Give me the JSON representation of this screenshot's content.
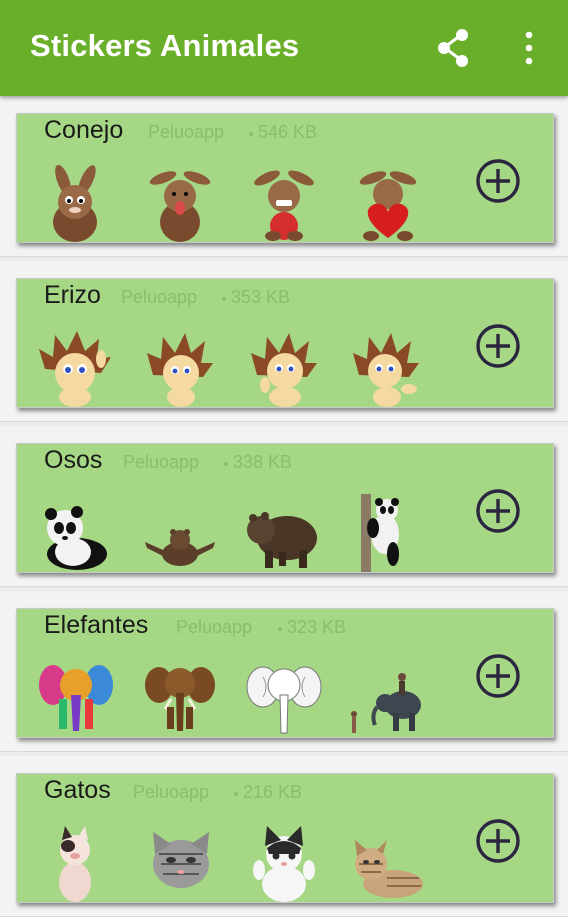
{
  "app": {
    "title": "Stickers Animales",
    "actions": {
      "share_icon": "share-icon",
      "more_icon": "more-vert-icon"
    },
    "colors": {
      "appbar": "#6aaf2a",
      "card": "#a5d784",
      "meta_text": "#8bbd6c",
      "icon": "#2b2540"
    }
  },
  "packs": [
    {
      "name": "Conejo",
      "author": "Peluoapp",
      "size": "546 KB",
      "stickers": [
        "rabbit-sticker",
        "rabbit-sticker",
        "rabbit-sticker",
        "rabbit-sticker"
      ]
    },
    {
      "name": "Erizo",
      "author": "Peluoapp",
      "size": "353 KB",
      "stickers": [
        "hedgehog-sticker",
        "hedgehog-sticker",
        "hedgehog-sticker",
        "hedgehog-sticker"
      ]
    },
    {
      "name": "Osos",
      "author": "Peluoapp",
      "size": "338 KB",
      "stickers": [
        "panda-sticker",
        "bear-sticker",
        "bear-sticker",
        "panda-sticker"
      ]
    },
    {
      "name": "Elefantes",
      "author": "Peluoapp",
      "size": "323 KB",
      "stickers": [
        "elephant-sticker",
        "elephant-sticker",
        "elephant-sticker",
        "elephant-sticker"
      ]
    },
    {
      "name": "Gatos",
      "author": "Peluoapp",
      "size": "216 KB",
      "stickers": [
        "cat-sticker",
        "cat-sticker",
        "cat-sticker",
        "cat-sticker"
      ]
    }
  ]
}
